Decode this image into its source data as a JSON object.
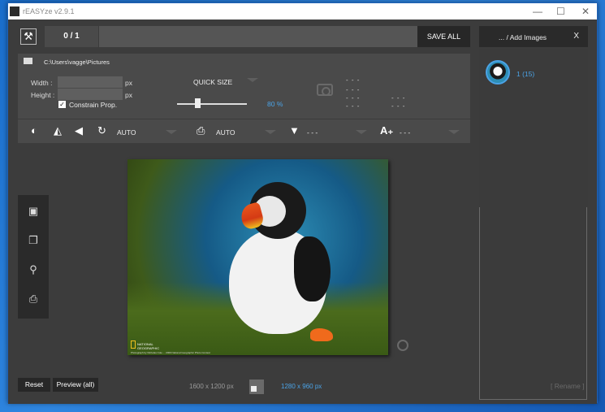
{
  "window": {
    "title": "rEASYze v2.9.1",
    "controls": [
      "—",
      "☐",
      "✕"
    ]
  },
  "topbar": {
    "counter": "0 / 1",
    "save_all": "SAVE ALL"
  },
  "settings": {
    "folder_path": "C:\\Users\\vagge\\Pictures",
    "width_label": "Width :",
    "height_label": "Height :",
    "width_value": "",
    "height_value": "",
    "width_unit": "px",
    "height_unit": "px",
    "constrain_label": "Constrain Prop.",
    "constrain_checked": true,
    "quick_size_label": "QUICK SIZE",
    "slider_value": "80 %",
    "slider_fraction": 0.3,
    "info_dashes": [
      "- - -",
      "- - -",
      "- - -",
      "- - -",
      "- - -",
      "- - -"
    ]
  },
  "toolbar": {
    "rotate_mode": "AUTO",
    "print_mode": "AUTO",
    "filter_value": "- - -",
    "text_value": "- - -"
  },
  "image": {
    "logo_text_1": "NATIONAL",
    "logo_text_2": "GEOGRAPHIC",
    "credit": "Photograph by Nicholas Cole ... 2009 National Geographic Photo Contest"
  },
  "bottom": {
    "reset_label": "Reset",
    "preview_label": "Preview (all)",
    "original_dims": "1600 x 1200 px",
    "new_dims": "1280 x 960 px"
  },
  "right_panel": {
    "add_images_label": "... / Add Images",
    "close_label": "X",
    "thumb_label": "1 (15)",
    "rename_label": "[ Rename ]"
  },
  "colors": {
    "accent": "#4ba3e6",
    "panel_bg": "#4a4a4a",
    "window_bg": "#3c3c3c",
    "dark_button": "#272727"
  }
}
